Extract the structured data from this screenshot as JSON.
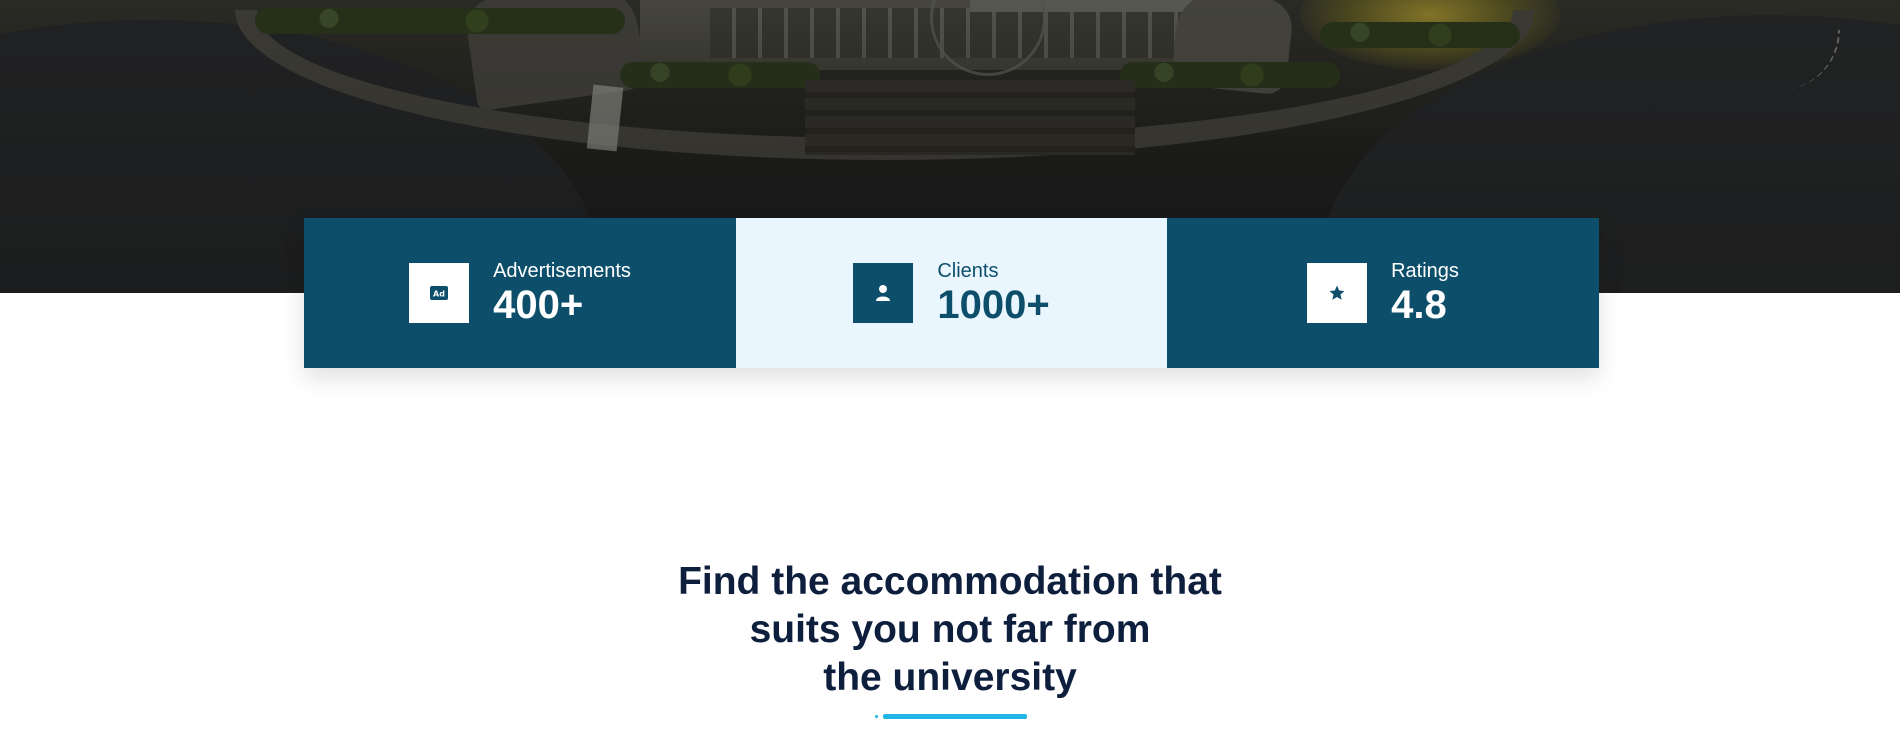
{
  "colors": {
    "primary": "#0d4f6b",
    "light_panel": "#eaf6fd",
    "heading": "#0e1f3d",
    "accent": "#1fb6e6"
  },
  "stats": [
    {
      "icon": "ad-icon",
      "label": "Advertisements",
      "value": "400+"
    },
    {
      "icon": "user-icon",
      "label": "Clients",
      "value": "1000+"
    },
    {
      "icon": "star-icon",
      "label": "Ratings",
      "value": "4.8"
    }
  ],
  "section": {
    "heading_lines": [
      "Find the accommodation that",
      "suits you not far from",
      "the university"
    ]
  }
}
